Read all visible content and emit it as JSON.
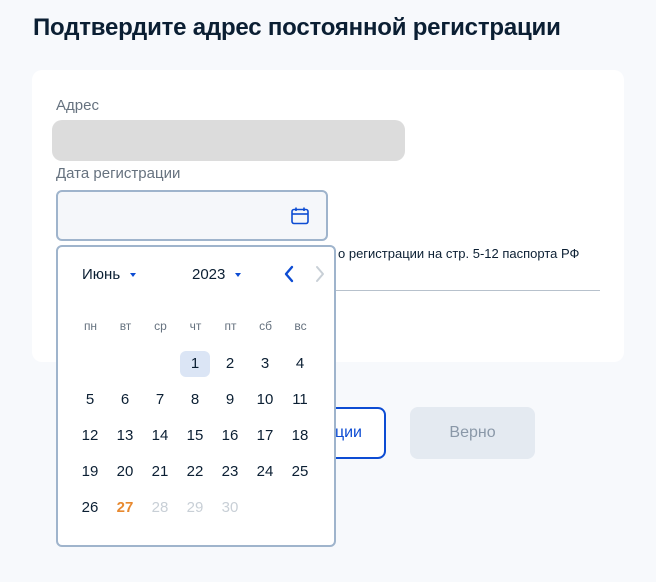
{
  "page": {
    "title": "Подтвердите адрес постоянной регистрации"
  },
  "form": {
    "address_label": "Адрес",
    "date_label": "Дата регистрации",
    "date_value": "",
    "hint_text": "о регистрации на стр. 5-12 паспорта РФ"
  },
  "buttons": {
    "secondary_label": "ции",
    "primary_label": "Верно"
  },
  "datepicker": {
    "month": "Июнь",
    "year": "2023",
    "weekdays": [
      "пн",
      "вт",
      "ср",
      "чт",
      "пт",
      "сб",
      "вс"
    ],
    "first_weekday_index": 3,
    "days_in_month": 30,
    "selected_day": 1,
    "today_day": 27,
    "disabled_from_day": 28,
    "prev_icon": "chevron-left-icon",
    "next_icon": "chevron-right-icon"
  },
  "colors": {
    "accent": "#0d4cd3",
    "today": "#e8892f",
    "selected_bg": "#dbe5f5",
    "disabled_text": "#c8cfd6"
  }
}
